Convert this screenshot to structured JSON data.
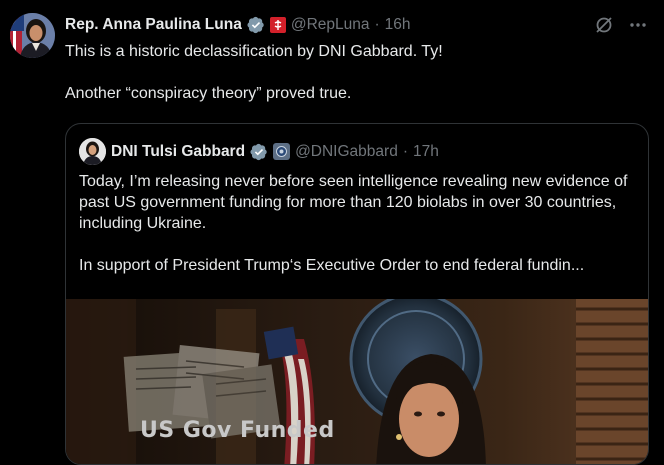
{
  "post": {
    "author_name": "Rep. Anna Paulina Luna",
    "handle": "@RepLuna",
    "separator": "·",
    "time": "16h",
    "body": [
      "This is a historic declassification by DNI Gabbard. Ty!",
      "Another “conspiracy theory” proved true."
    ]
  },
  "quoted_post": {
    "author_name": "DNI Tulsi Gabbard",
    "handle": "@DNIGabbard",
    "separator": "·",
    "time": "17h",
    "body": [
      "Today, I’m releasing never before seen intelligence revealing new evidence of past US government funding for more than 120 biolabs in over 30 countries, including Ukraine.",
      "In support of President Trump‘s Executive Order to end federal fundin..."
    ],
    "media_caption": "US Gov Funded"
  },
  "icons": {
    "verified": "verified-badge-icon",
    "affiliate": "house-affiliate-icon",
    "gov_affiliate": "gov-affiliate-icon",
    "grok": "grok-icon",
    "more": "more-icon"
  },
  "colors": {
    "background": "#000000",
    "text": "#e7e9ea",
    "secondary_text": "#71767b",
    "verified": "#829aab",
    "border": "#2f3336"
  }
}
